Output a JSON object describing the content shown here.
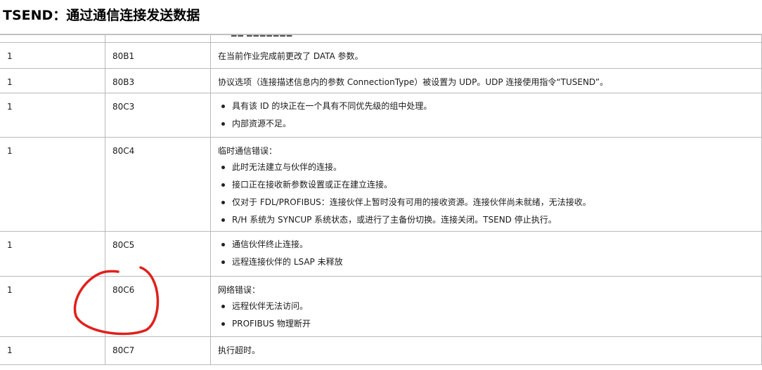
{
  "title": "TSEND：通过通信连接发送数据",
  "colors": {
    "annotation": "#e0201b",
    "border": "#b9b9b9"
  },
  "rows": [
    {
      "col1": "1",
      "col2": "80B1",
      "text": "在当前作业完成前更改了 DATA 参数。"
    },
    {
      "col1": "1",
      "col2": "80B3",
      "text": "协议选项（连接描述信息内的参数 ConnectionType）被设置为 UDP。UDP 连接使用指令“TUSEND”。"
    },
    {
      "col1": "1",
      "col2": "80C3",
      "bullets": [
        "具有该 ID 的块正在一个具有不同优先级的组中处理。",
        "内部资源不足。"
      ]
    },
    {
      "col1": "1",
      "col2": "80C4",
      "text": "临时通信错误：",
      "bullets": [
        "此时无法建立与伙伴的连接。",
        "接口正在接收新参数设置或正在建立连接。",
        "仅对于 FDL/PROFIBUS：连接伙伴上暂时没有可用的接收资源。连接伙伴尚未就绪，无法接收。",
        "R/H 系统为 SYNCUP 系统状态，或进行了主备份切换。连接关闭。TSEND 停止执行。"
      ]
    },
    {
      "col1": "1",
      "col2": "80C5",
      "bullets": [
        "通信伙伴终止连接。",
        "远程连接伙伴的 LSAP 未释放"
      ]
    },
    {
      "col1": "1",
      "col2": "80C6",
      "text": "网络错误：",
      "bullets": [
        "远程伙伴无法访问。",
        "PROFIBUS 物理断开"
      ]
    },
    {
      "col1": "1",
      "col2": "80C7",
      "text": "执行超时。"
    }
  ]
}
